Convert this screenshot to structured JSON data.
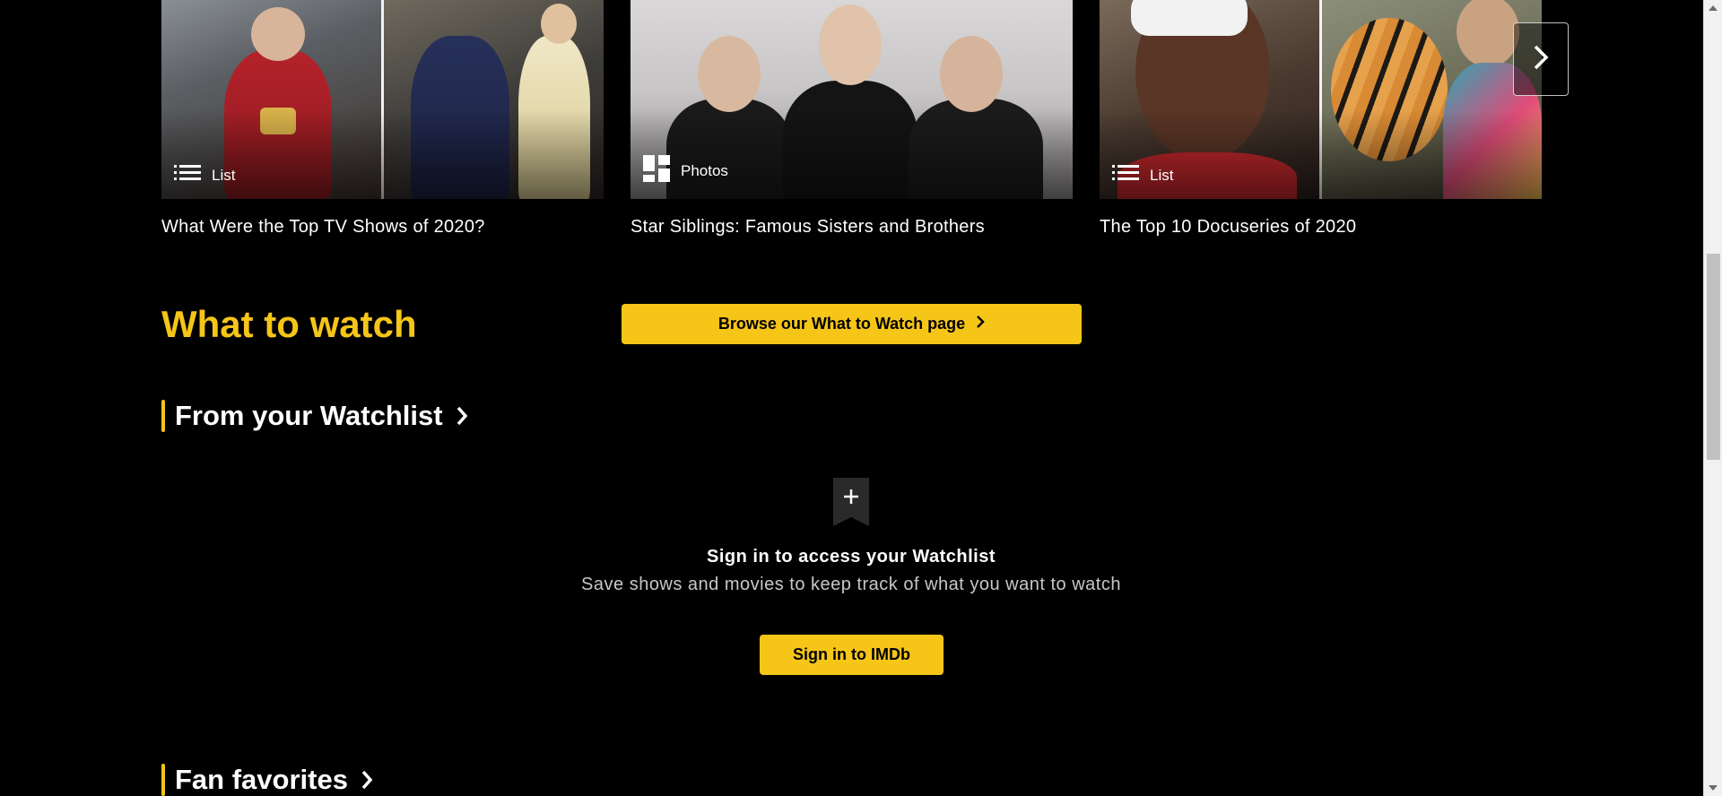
{
  "carousel": {
    "cards": [
      {
        "badge_label": "List",
        "badge_icon": "list-icon",
        "title": "What Were the Top TV Shows of 2020?"
      },
      {
        "badge_label": "Photos",
        "badge_icon": "photos-icon",
        "title": "Star Siblings: Famous Sisters and Brothers"
      },
      {
        "badge_label": "List",
        "badge_icon": "list-icon",
        "title": "The Top 10 Docuseries of 2020"
      }
    ],
    "next_icon": "chevron-right-icon"
  },
  "what_to_watch": {
    "heading": "What to watch",
    "browse_label": "Browse our What to Watch page",
    "browse_icon": "chevron-right-icon"
  },
  "watchlist": {
    "header": "From your Watchlist",
    "ribbon_icon": "add-to-watchlist-icon",
    "signin_title": "Sign in to access your Watchlist",
    "signin_subtitle": "Save shows and movies to keep track of what you want to watch",
    "signin_button": "Sign in to IMDb"
  },
  "fan_favorites": {
    "header": "Fan favorites"
  },
  "colors": {
    "accent": "#f5c518",
    "background": "#000000",
    "text": "#ffffff",
    "muted_text": "#c7c7c7"
  }
}
